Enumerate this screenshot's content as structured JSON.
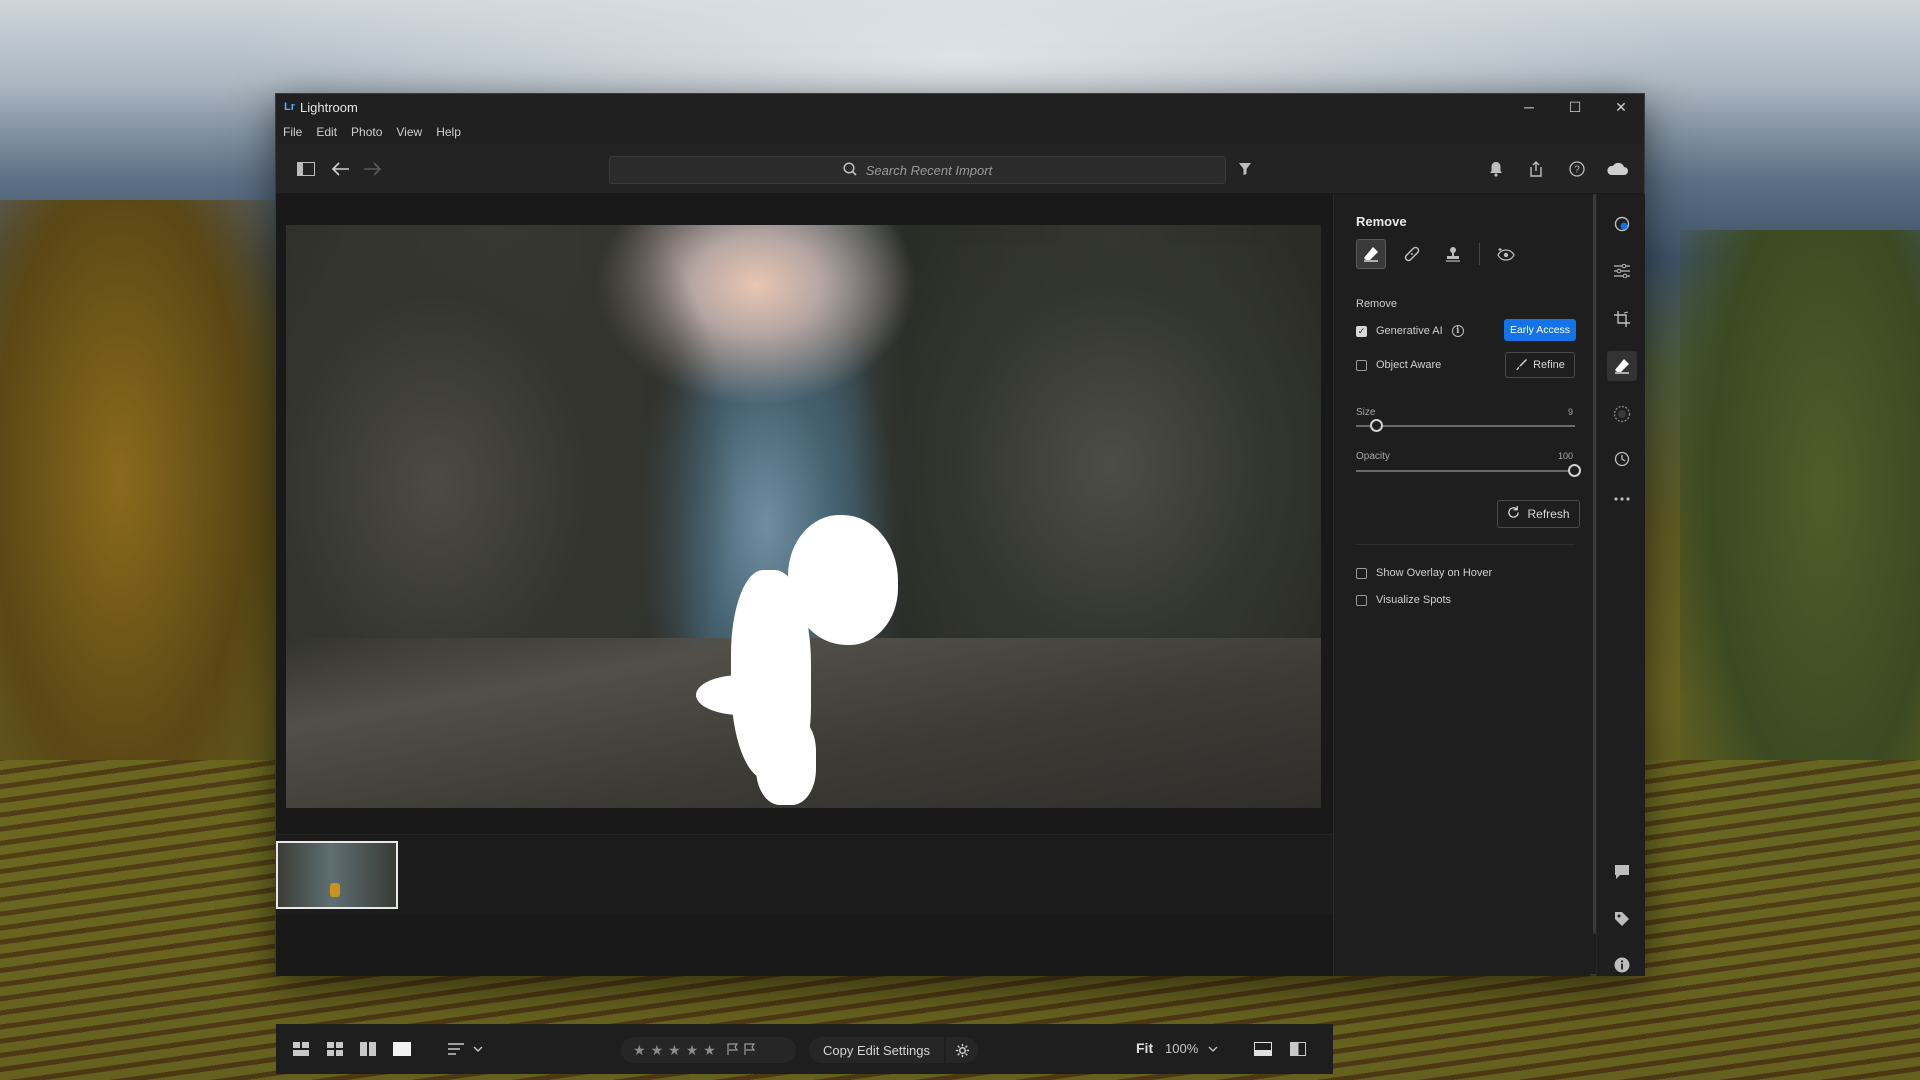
{
  "window": {
    "title": "Lightroom",
    "controls": {
      "minimize": "─",
      "maximize": "☐",
      "close": "✕"
    }
  },
  "menu": [
    "File",
    "Edit",
    "Photo",
    "View",
    "Help"
  ],
  "toolbar": {
    "search_placeholder": "Search Recent Import",
    "icons": [
      "sidebar-toggle-icon",
      "back-arrow-icon",
      "forward-arrow-icon",
      "filter-icon",
      "bell-icon",
      "share-icon",
      "help-icon",
      "cloud-icon"
    ]
  },
  "panel": {
    "title": "Remove",
    "tools": [
      "remove-eraser-icon",
      "heal-bandage-icon",
      "clone-stamp-icon",
      "red-eye-icon"
    ],
    "section_title": "Remove",
    "generative_ai": {
      "label": "Generative AI",
      "checked": true
    },
    "early_access_label": "Early Access",
    "object_aware": {
      "label": "Object Aware",
      "checked": false
    },
    "refine_label": "Refine",
    "size": {
      "label": "Size",
      "value": "9",
      "fraction": 0.09
    },
    "opacity": {
      "label": "Opacity",
      "value": "100",
      "fraction": 1.0
    },
    "refresh_label": "Refresh",
    "show_overlay": {
      "label": "Show Overlay on Hover",
      "checked": false
    },
    "visualize_spots": {
      "label": "Visualize Spots",
      "checked": false
    }
  },
  "rail": {
    "top_icons": [
      "color-profile-icon",
      "edit-sliders-icon",
      "crop-icon",
      "remove-eraser-icon",
      "masking-icon",
      "history-icon",
      "more-icon"
    ],
    "bottom_icons": [
      "comment-icon",
      "keyword-tag-icon",
      "info-icon"
    ]
  },
  "bottombar": {
    "view_icons": [
      "grid-large-icon",
      "grid-small-icon",
      "compare-icon",
      "detail-view-icon",
      "sort-icon"
    ],
    "stars": [
      "★",
      "★",
      "★",
      "★",
      "★"
    ],
    "flags": [
      "flag-pick-icon",
      "flag-reject-icon"
    ],
    "copy_edit_label": "Copy Edit Settings",
    "fit_label": "Fit",
    "zoom_value": "100%",
    "right_icons": [
      "filmstrip-toggle-icon",
      "before-after-icon"
    ]
  },
  "colors": {
    "accent": "#1473e6",
    "window_bg": "#1e1e1e"
  }
}
